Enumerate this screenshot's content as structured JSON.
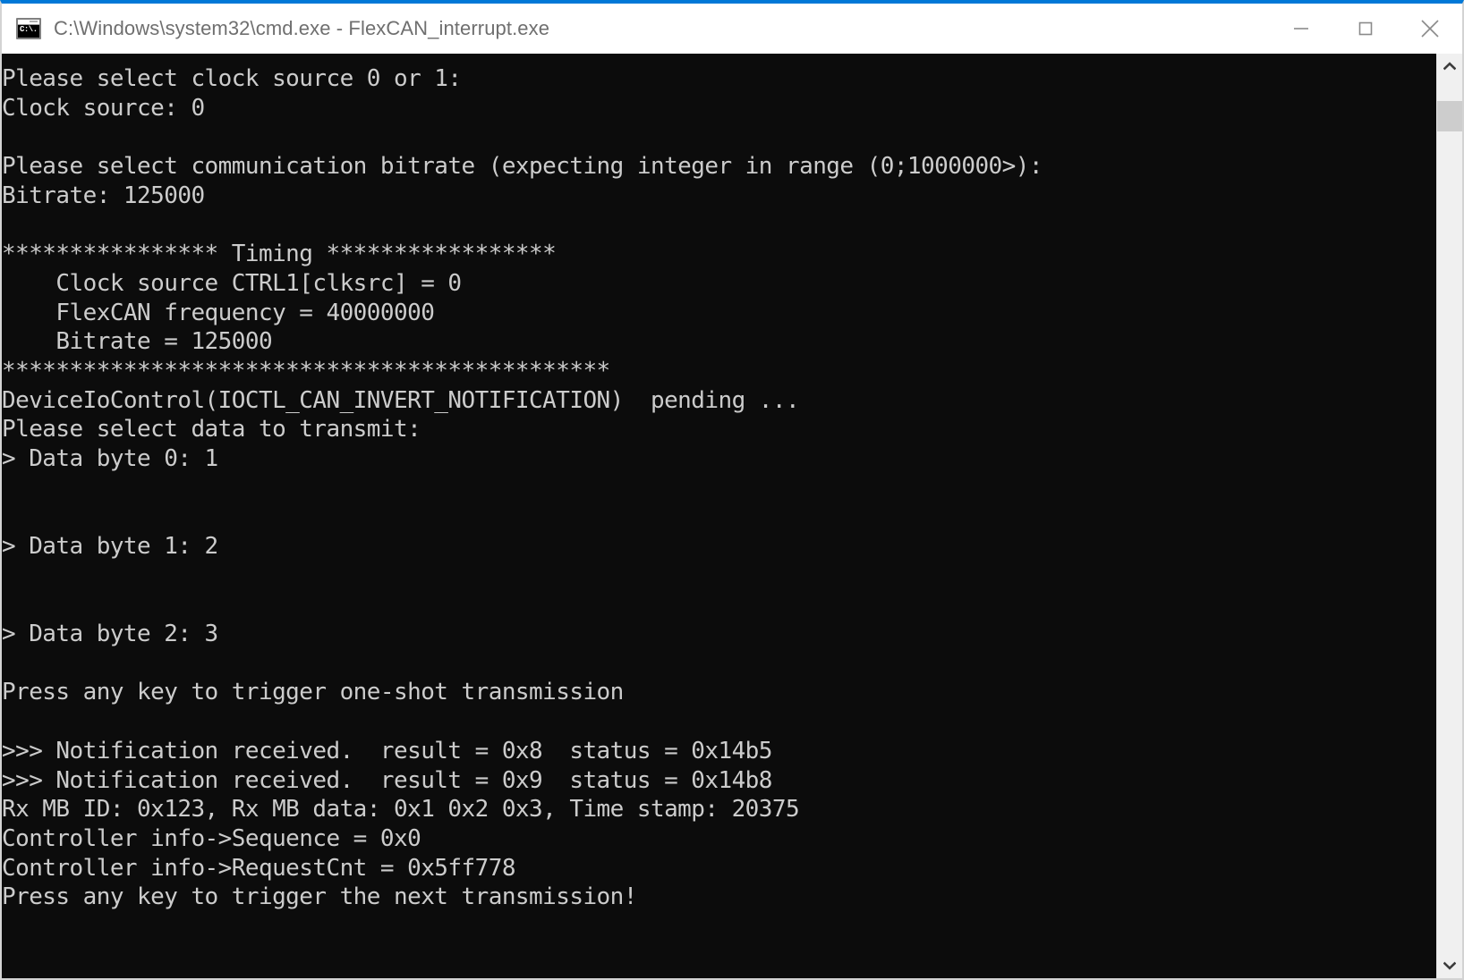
{
  "window": {
    "title": "C:\\Windows\\system32\\cmd.exe - FlexCAN_interrupt.exe",
    "icon_name": "cmd-console-icon",
    "icon_text": "C:\\.",
    "accent_color": "#0078d7",
    "titlebar_background": "#ffffff",
    "title_color": "#6f6f6f"
  },
  "window_controls": {
    "minimize_label": "Minimize",
    "maximize_label": "Maximize",
    "close_label": "Close"
  },
  "console": {
    "background_color": "#0c0c0c",
    "foreground_color": "#cccccc",
    "lines": [
      "Please select clock source 0 or 1:",
      "Clock source: 0",
      "",
      "Please select communication bitrate (expecting integer in range (0;1000000>):",
      "Bitrate: 125000",
      "",
      "**************** Timing *****************",
      "    Clock source CTRL1[clksrc] = 0",
      "    FlexCAN frequency = 40000000",
      "    Bitrate = 125000",
      "*********************************************",
      "DeviceIoControl(IOCTL_CAN_INVERT_NOTIFICATION)  pending ...",
      "Please select data to transmit:",
      "> Data byte 0: 1",
      "",
      "",
      "> Data byte 1: 2",
      "",
      "",
      "> Data byte 2: 3",
      "",
      "Press any key to trigger one-shot transmission",
      "",
      ">>> Notification received.  result = 0x8  status = 0x14b5",
      ">>> Notification received.  result = 0x9  status = 0x14b8",
      "Rx MB ID: 0x123, Rx MB data: 0x1 0x2 0x3, Time stamp: 20375",
      "Controller info->Sequence = 0x0",
      "Controller info->RequestCnt = 0x5ff778",
      "Press any key to trigger the next transmission!"
    ]
  },
  "scrollbar": {
    "up_arrow_name": "scroll-up-arrow",
    "down_arrow_name": "scroll-down-arrow",
    "track_color": "#f0f0f0",
    "thumb_color": "#cdcdcd"
  }
}
